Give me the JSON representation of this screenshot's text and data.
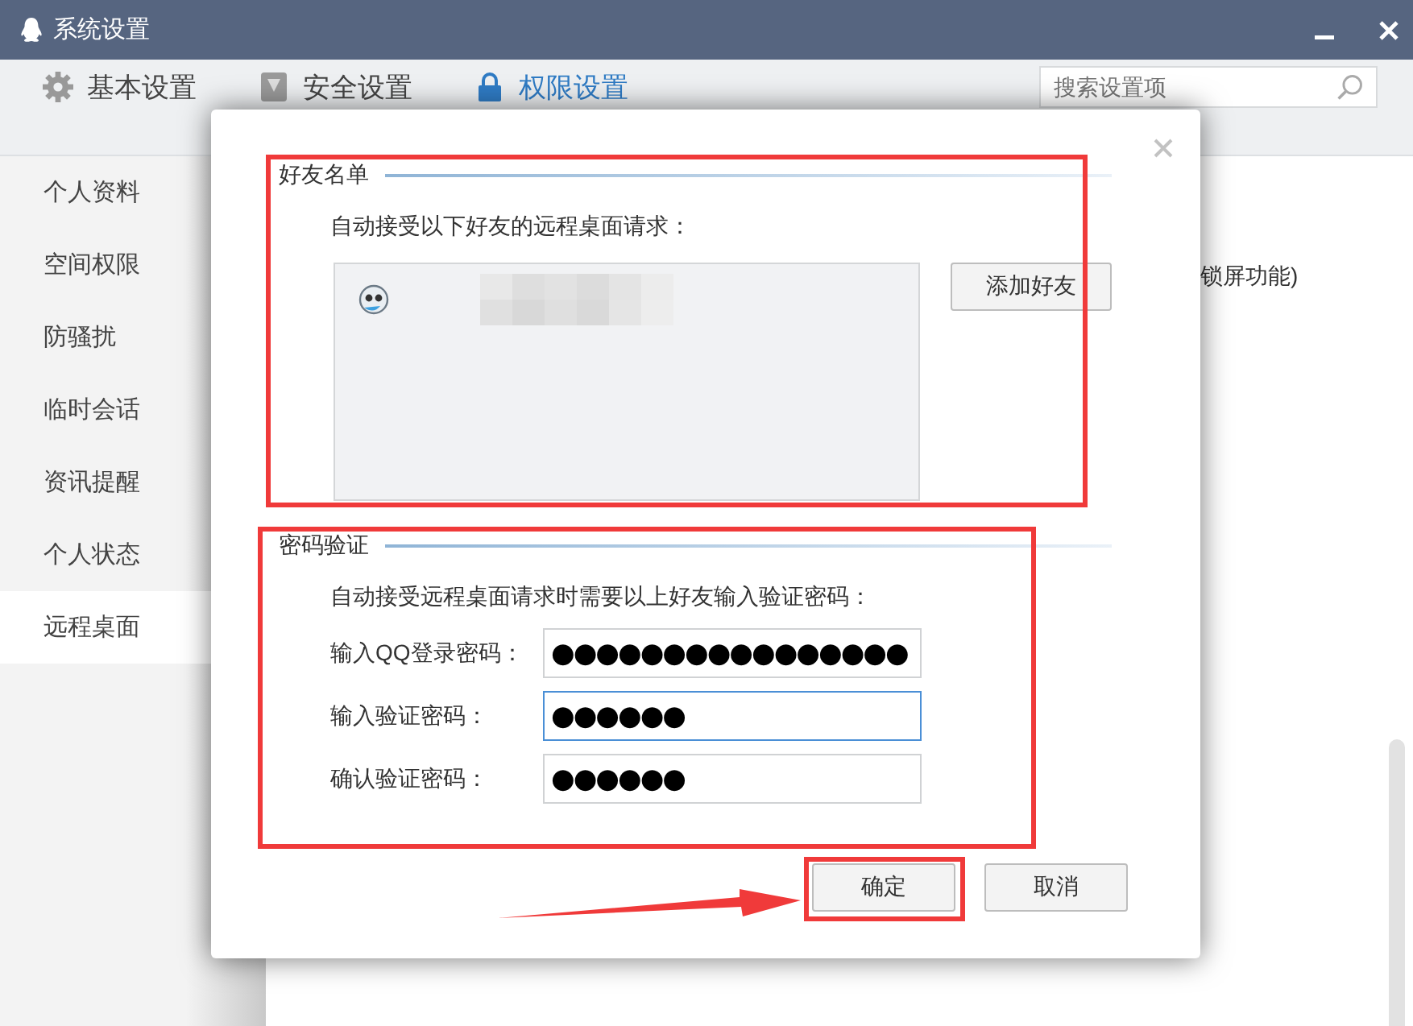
{
  "window": {
    "title": "系统设置"
  },
  "tabs": [
    {
      "label": "基本设置",
      "selected": false
    },
    {
      "label": "安全设置",
      "selected": false
    },
    {
      "label": "权限设置",
      "selected": true
    }
  ],
  "search": {
    "placeholder": "搜索设置项"
  },
  "sidebar": {
    "items": [
      {
        "label": "个人资料",
        "selected": false
      },
      {
        "label": "空间权限",
        "selected": false
      },
      {
        "label": "防骚扰",
        "selected": false
      },
      {
        "label": "临时会话",
        "selected": false
      },
      {
        "label": "资讯提醒",
        "selected": false
      },
      {
        "label": "个人状态",
        "selected": false
      },
      {
        "label": "远程桌面",
        "selected": true
      }
    ]
  },
  "background_text": "锁屏功能)",
  "dialog": {
    "friend_section": {
      "title": "好友名单",
      "description": "自动接受以下好友的远程桌面请求：",
      "add_button": "添加好友"
    },
    "password_section": {
      "title": "密码验证",
      "description": "自动接受远程桌面请求时需要以上好友输入验证密码：",
      "fields": [
        {
          "label": "输入QQ登录密码：",
          "value": "●●●●●●●●●●●●●●●●",
          "focused": false
        },
        {
          "label": "输入验证密码：",
          "value": "●●●●●●",
          "focused": true
        },
        {
          "label": "确认验证密码：",
          "value": "●●●●●●",
          "focused": false
        }
      ]
    },
    "buttons": [
      "确定",
      "取消"
    ]
  }
}
